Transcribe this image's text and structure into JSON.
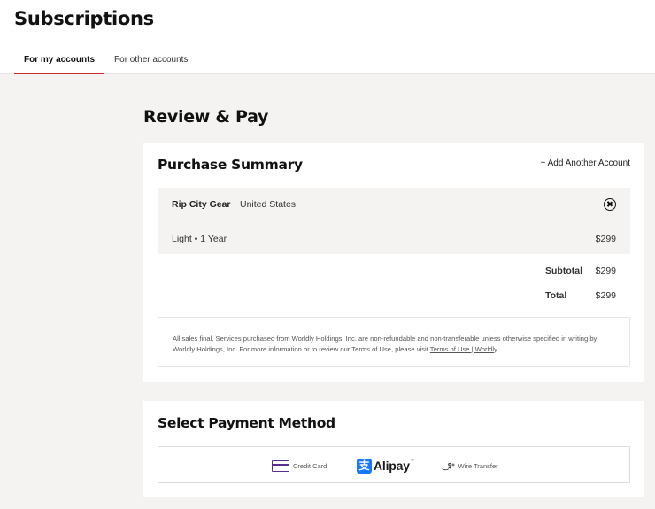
{
  "header": {
    "title": "Subscriptions",
    "tabs": [
      {
        "label": "For my accounts",
        "active": true
      },
      {
        "label": "For other accounts",
        "active": false
      }
    ]
  },
  "review": {
    "title": "Review & Pay"
  },
  "summary": {
    "title": "Purchase Summary",
    "add_account_label": "+ Add Another Account",
    "account": {
      "name": "Rip City Gear",
      "country": "United States",
      "plan": "Light • 1 Year",
      "price": "$299"
    },
    "subtotal_label": "Subtotal",
    "subtotal_value": "$299",
    "total_label": "Total",
    "total_value": "$299",
    "terms_text": "All sales final. Services purchased from Worldly Holdings, Inc. are non-refundable and non-transferable unless otherwise specified in writing by Worldly Holdings, Inc. For more information or to review our Terms of Use, please visit ",
    "terms_link": "Terms of Use | Worldly"
  },
  "payment": {
    "title": "Select Payment Method",
    "methods": {
      "credit_card": "Credit Card",
      "alipay_glyph": "支",
      "alipay": "Alipay",
      "alipay_tm": "™",
      "wire_glyph": "‿$⁺",
      "wire": "Wire Transfer"
    }
  },
  "colors": {
    "accent_red": "#d22b2b",
    "alipay_blue": "#1677ff",
    "card_purple": "#5b2d8e",
    "page_bg": "#f4f3f1"
  }
}
